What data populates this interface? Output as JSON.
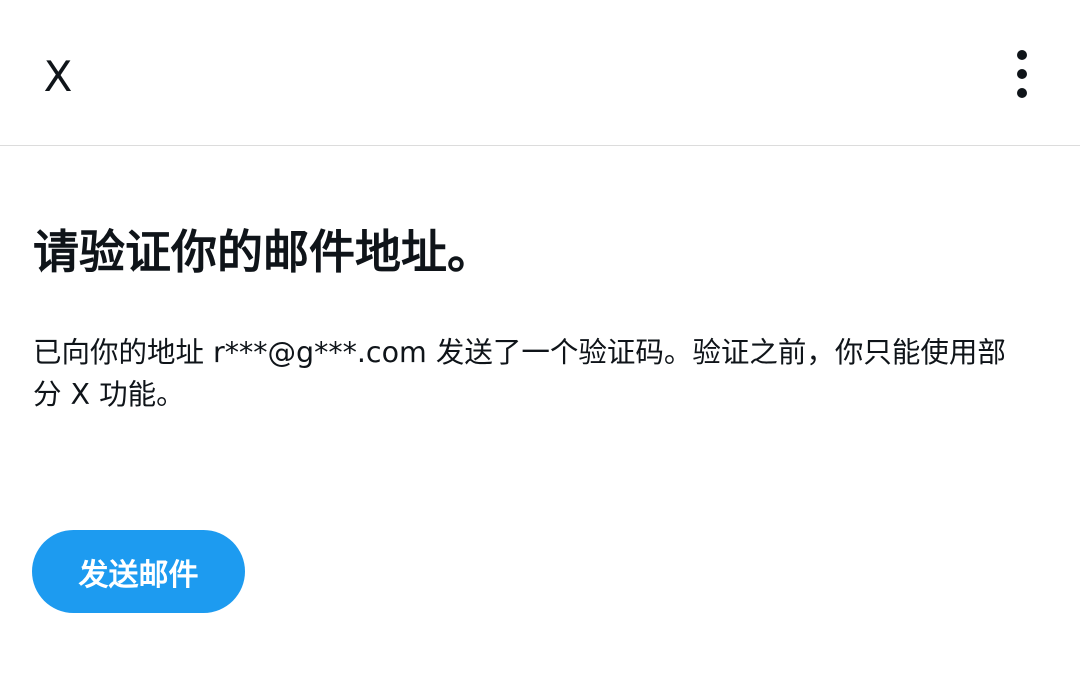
{
  "header": {
    "close_label": "X",
    "close_icon": "close-icon",
    "more_icon": "more-vertical-icon"
  },
  "main": {
    "title": "请验证你的邮件地址。",
    "description": "已向你的地址 r***@g***.com 发送了一个验证码。验证之前，你只能使用部分 X 功能。",
    "send_button_label": "发送邮件"
  },
  "colors": {
    "accent": "#1d9bf0",
    "text": "#0f1419",
    "divider": "#dcdcdc",
    "background": "#ffffff"
  }
}
